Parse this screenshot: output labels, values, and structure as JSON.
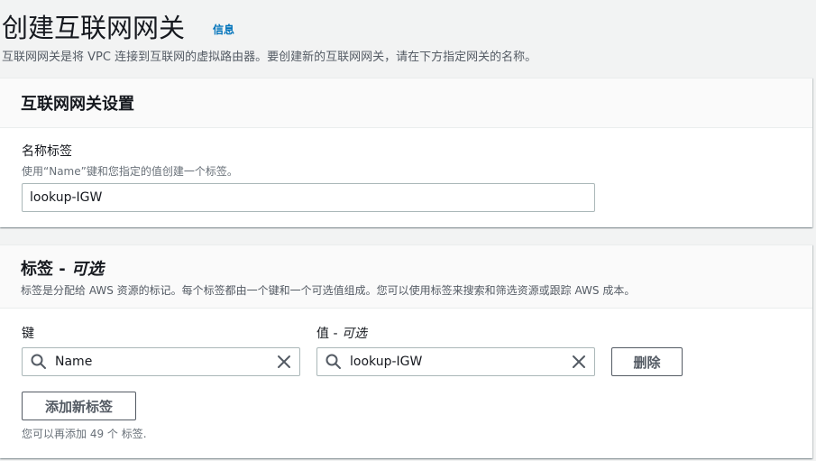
{
  "header": {
    "title": "创建互联网网关",
    "info_link": "信息",
    "description": "互联网网关是将 VPC 连接到互联网的虚拟路由器。要创建新的互联网网关，请在下方指定网关的名称。"
  },
  "settings_panel": {
    "title": "互联网网关设置",
    "name_tag_label": "名称标签",
    "name_tag_description": "使用“Name”键和您指定的值创建一个标签。",
    "name_tag_value": "lookup-IGW"
  },
  "tags_panel": {
    "title": "标签 -",
    "title_optional": "可选",
    "description": "标签是分配给 AWS 资源的标记。每个标签都由一个键和一个可选值组成。您可以使用标签来搜索和筛选资源或跟踪 AWS 成本。",
    "key_label": "键",
    "value_label": "值 -",
    "value_label_optional": "可选",
    "key_value": "Name",
    "value_value": "lookup-IGW",
    "remove_button": "删除",
    "add_tag_button": "添加新标签",
    "remaining_text": "您可以再添加 49 个 标签."
  },
  "icons": {
    "search": "search-icon",
    "clear": "close-icon"
  }
}
